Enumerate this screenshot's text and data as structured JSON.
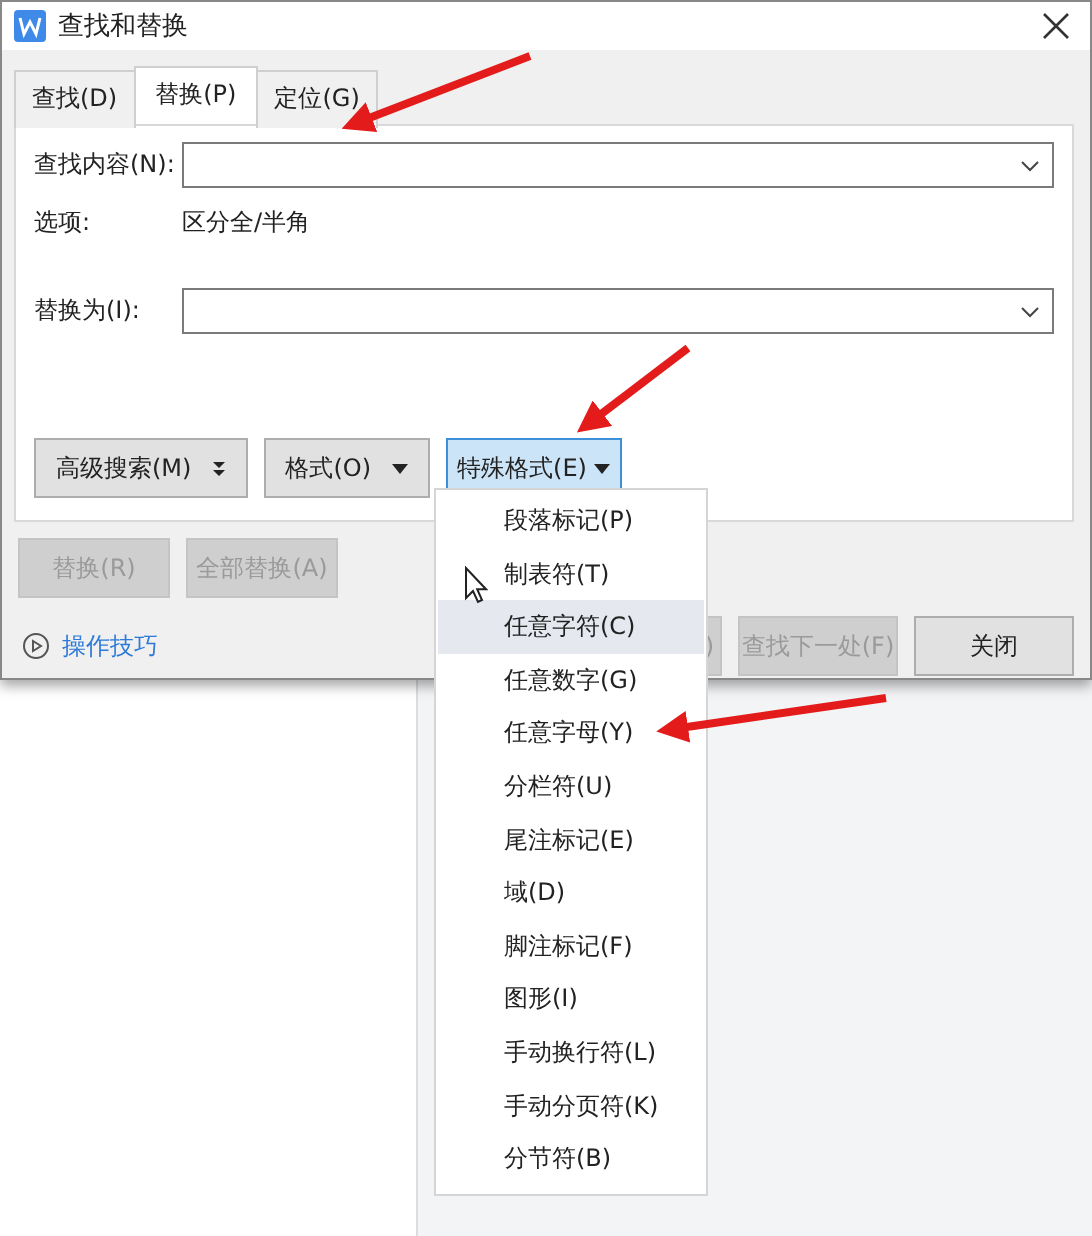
{
  "window": {
    "title": "查找和替换"
  },
  "tabs": [
    {
      "label": "查找(D)",
      "selected": false
    },
    {
      "label": "替换(P)",
      "selected": true
    },
    {
      "label": "定位(G)",
      "selected": false
    }
  ],
  "find": {
    "label": "查找内容(N):"
  },
  "options": {
    "label": "选项:",
    "value": "区分全/半角"
  },
  "replace": {
    "label": "替换为(I):"
  },
  "format_buttons": [
    {
      "label": "高级搜索(M)",
      "kind": "double",
      "selected": false
    },
    {
      "label": "格式(O)",
      "kind": "single",
      "selected": false
    },
    {
      "label": "特殊格式(E)",
      "kind": "single",
      "selected": true
    }
  ],
  "action_buttons": [
    {
      "label": "替换(R)",
      "disabled": true
    },
    {
      "label": "全部替换(A)",
      "disabled": true
    }
  ],
  "tips_link": "操作技巧",
  "bottom_buttons": [
    {
      "label": ")",
      "disabled": true,
      "kind": "partial"
    },
    {
      "label": "查找下一处(F)",
      "disabled": true,
      "kind": "full"
    },
    {
      "label": "关闭",
      "disabled": false,
      "kind": "full"
    }
  ],
  "menu": {
    "items": [
      {
        "label": "段落标记(P)",
        "selected": false
      },
      {
        "label": "制表符(T)",
        "selected": false
      },
      {
        "label": "任意字符(C)",
        "selected": true
      },
      {
        "label": "任意数字(G)",
        "selected": false
      },
      {
        "label": "任意字母(Y)",
        "selected": false
      },
      {
        "label": "分栏符(U)",
        "selected": false
      },
      {
        "label": "尾注标记(E)",
        "selected": false
      },
      {
        "label": "域(D)",
        "selected": false
      },
      {
        "label": "脚注标记(F)",
        "selected": false
      },
      {
        "label": "图形(I)",
        "selected": false
      },
      {
        "label": "手动换行符(L)",
        "selected": false
      },
      {
        "label": "手动分页符(K)",
        "selected": false
      },
      {
        "label": "分节符(B)",
        "selected": false
      }
    ]
  }
}
